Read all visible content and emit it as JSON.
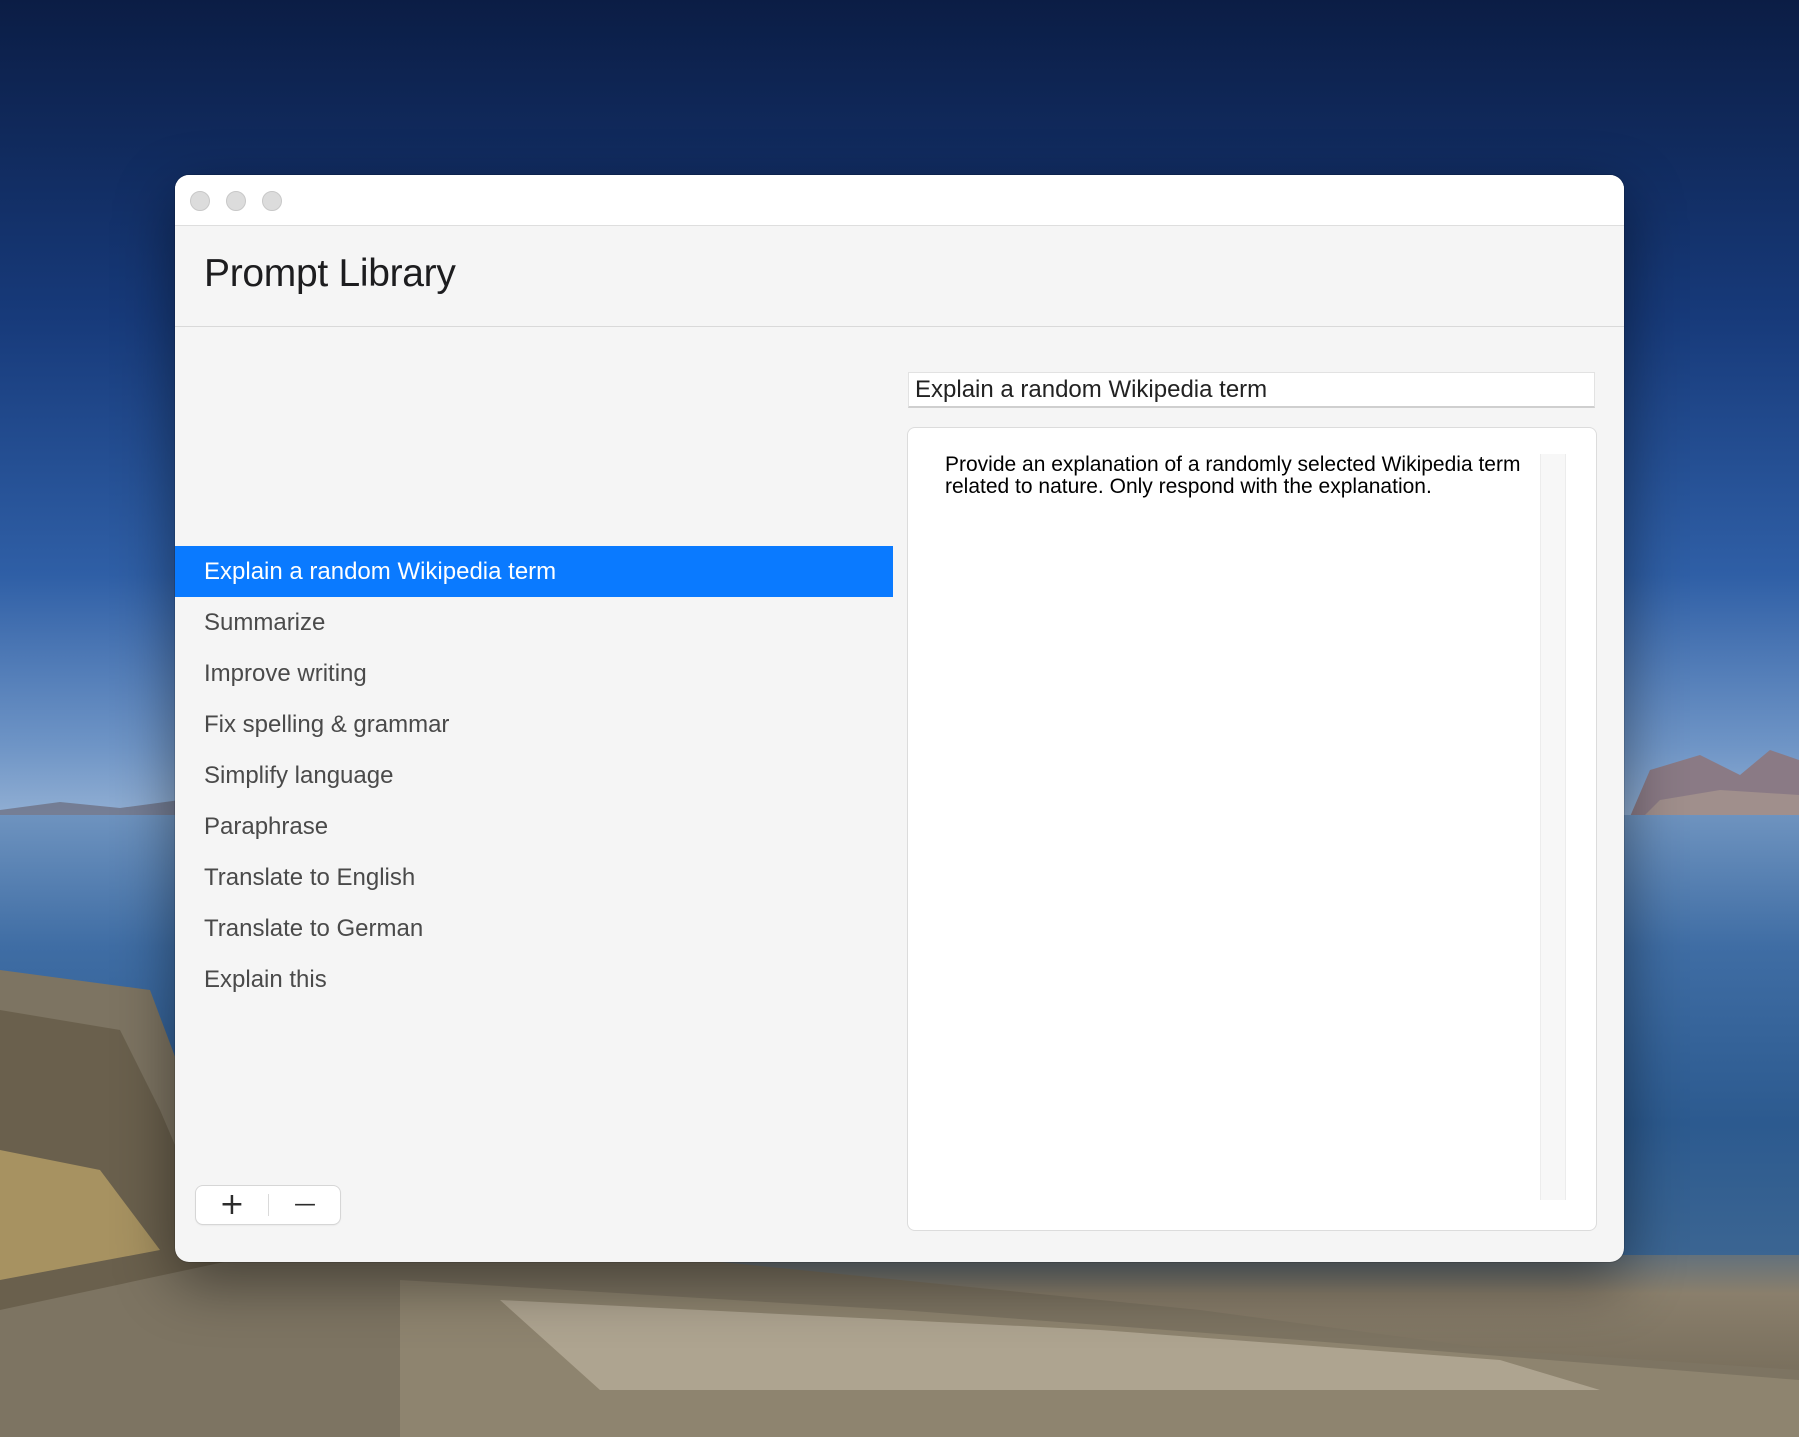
{
  "window": {
    "title": "Prompt Library"
  },
  "sidebar": {
    "items": [
      {
        "label": "Explain a random Wikipedia term",
        "selected": true
      },
      {
        "label": "Summarize",
        "selected": false
      },
      {
        "label": "Improve writing",
        "selected": false
      },
      {
        "label": "Fix spelling & grammar",
        "selected": false
      },
      {
        "label": "Simplify language",
        "selected": false
      },
      {
        "label": "Paraphrase",
        "selected": false
      },
      {
        "label": "Translate to English",
        "selected": false
      },
      {
        "label": "Translate to German",
        "selected": false
      },
      {
        "label": "Explain this",
        "selected": false
      }
    ],
    "add_label": "+",
    "remove_label": "—"
  },
  "detail": {
    "name_value": "Explain a random Wikipedia term",
    "prompt_text": "Provide an explanation of a randomly selected Wikipedia term related to nature. Only respond with the explanation."
  },
  "colors": {
    "accent": "#0a7aff",
    "window_bg": "#f5f5f5"
  },
  "icons": {
    "close": "close-icon",
    "minimize": "minimize-icon",
    "zoom": "zoom-icon"
  }
}
